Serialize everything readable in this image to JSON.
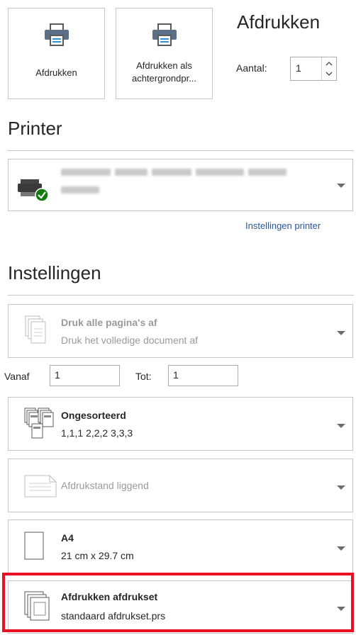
{
  "print": {
    "print_button_label": "Afdrukken",
    "print_background_label_line1": "Afdrukken als",
    "print_background_label_line2": "achtergrondpr...",
    "title": "Afdrukken",
    "copies_label": "Aantal:",
    "copies_value": "1"
  },
  "printer": {
    "section_title": "Printer",
    "printer_settings_link": "Instellingen printer"
  },
  "settings": {
    "section_title": "Instellingen",
    "pages_dropdown": {
      "title": "Druk alle pagina's af",
      "subtitle": "Druk het volledige document af"
    },
    "from_label": "Vanaf",
    "from_value": "1",
    "to_label": "Tot:",
    "to_value": "1",
    "collate_dropdown": {
      "title": "Ongesorteerd",
      "subtitle": "1,1,1   2,2,2   3,3,3"
    },
    "orientation_dropdown": {
      "title": "Afdrukstand liggend"
    },
    "paper_dropdown": {
      "title": "A4",
      "subtitle": "21 cm x 29.7 cm"
    },
    "printset_dropdown": {
      "title": "Afdrukken afdrukset",
      "subtitle": "standaard afdrukset.prs"
    }
  },
  "colors": {
    "highlight": "#e81123",
    "link": "#2b579a",
    "status_ok": "#107c10"
  }
}
